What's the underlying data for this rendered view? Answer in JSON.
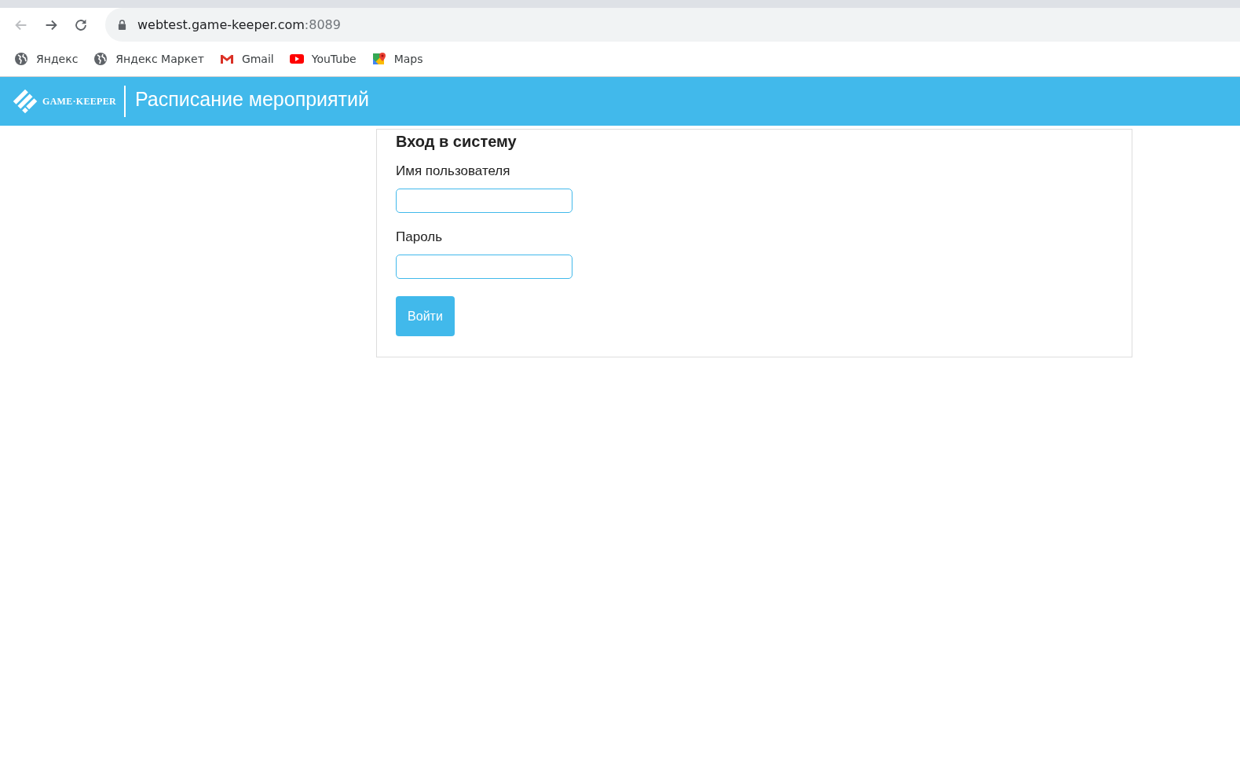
{
  "browser": {
    "nav": [
      {
        "kind": "back",
        "disabled": true
      },
      {
        "kind": "forward",
        "disabled": false
      },
      {
        "kind": "reload",
        "disabled": false
      }
    ],
    "address": {
      "host": "webtest.game-keeper.com",
      "port": ":8089"
    },
    "bookmarks": [
      {
        "kind": "globe",
        "label": "Яндекс"
      },
      {
        "kind": "globe",
        "label": "Яндекс Маркет"
      },
      {
        "kind": "gmail",
        "label": "Gmail"
      },
      {
        "kind": "youtube",
        "label": "YouTube"
      },
      {
        "kind": "maps",
        "label": "Maps"
      }
    ]
  },
  "header": {
    "logo_text": "GAME·KEEPER",
    "title": "Расписание мероприятий"
  },
  "login": {
    "title": "Вход в систему",
    "fields": [
      {
        "label": "Имя пользователя"
      },
      {
        "label": "Пароль"
      }
    ],
    "button": "Войти"
  }
}
